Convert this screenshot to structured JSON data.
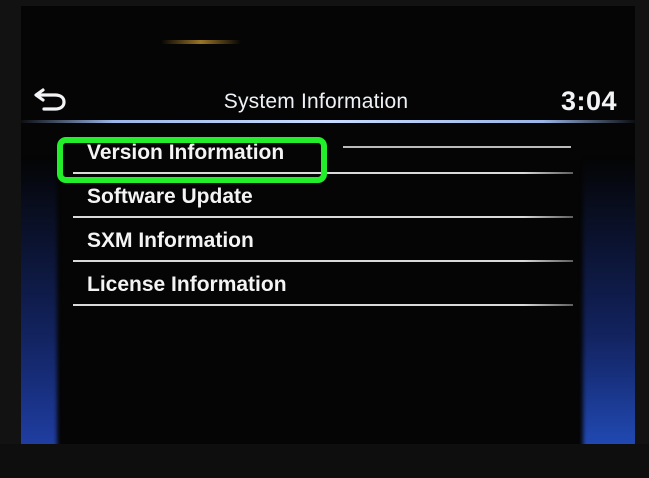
{
  "header": {
    "back_icon": "back-arrow-icon",
    "title": "System Information",
    "clock": "3:04"
  },
  "menu": {
    "items": [
      {
        "label": "Version Information",
        "highlighted": true
      },
      {
        "label": "Software Update",
        "highlighted": false
      },
      {
        "label": "SXM Information",
        "highlighted": false
      },
      {
        "label": "License Information",
        "highlighted": false
      }
    ]
  },
  "annotation": {
    "highlight_color": "#22ee2a"
  }
}
